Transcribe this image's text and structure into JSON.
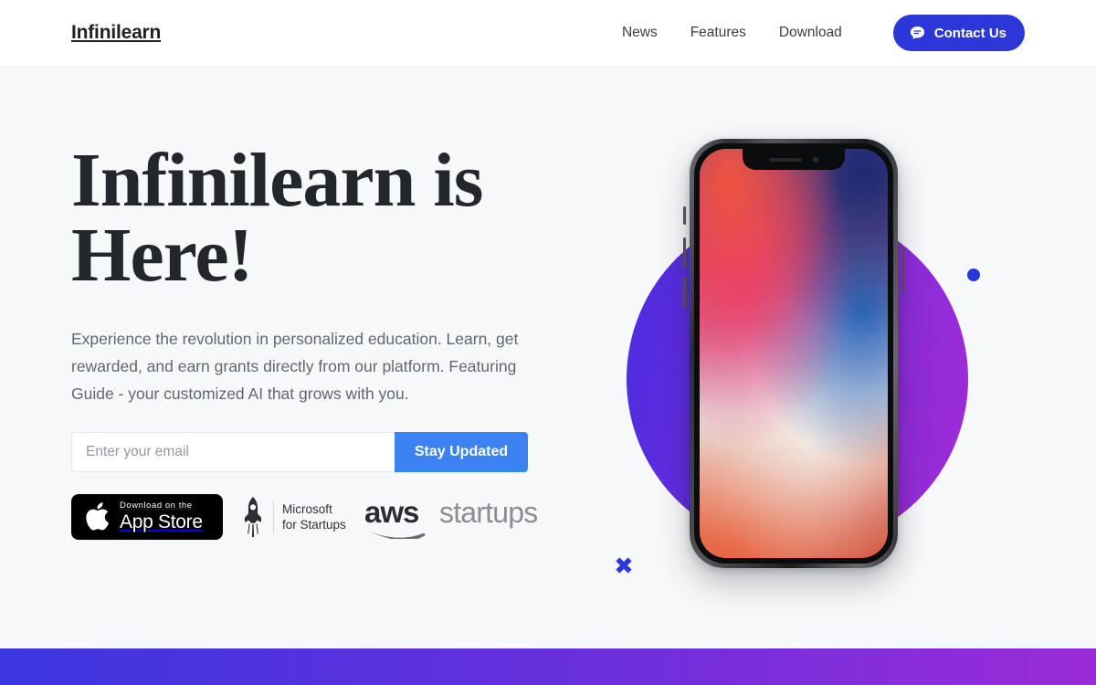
{
  "header": {
    "brand": "Infinilearn",
    "nav_links": [
      {
        "label": "News"
      },
      {
        "label": "Features"
      },
      {
        "label": "Download"
      }
    ],
    "contact_button": {
      "label": "Contact Us",
      "icon": "chat-bubble-icon",
      "background": "#2b37d8",
      "text_color": "#ffffff"
    }
  },
  "hero": {
    "headline": "Infinilearn is Here!",
    "subhead": "Experience the revolution in personalized education. Learn, get rewarded, and earn grants directly from our platform. Featuring Guide - your customized AI that grows with you.",
    "signup": {
      "email_placeholder": "Enter your email",
      "email_value": "",
      "submit_label": "Stay Updated",
      "submit_color": "#3c82f0"
    },
    "badges": {
      "appstore": {
        "icon": "apple-logo-icon",
        "small_label": "Download on the",
        "big_label": "App Store",
        "background": "#000000"
      },
      "microsoft": {
        "icon": "rocket-icon",
        "line1": "Microsoft",
        "line2": "for Startups"
      },
      "aws": {
        "mark": "aws",
        "word": "startups"
      }
    },
    "visual": {
      "blob_gradient_from": "#4a2ce2",
      "blob_gradient_to": "#a02bd6",
      "dot_color": "#2b37d8",
      "cross_color": "#2b37d8",
      "device": "iphone-x-mockup"
    }
  },
  "footer_band": {
    "gradient_from": "#3b36e0",
    "gradient_to": "#9a2bd8"
  }
}
